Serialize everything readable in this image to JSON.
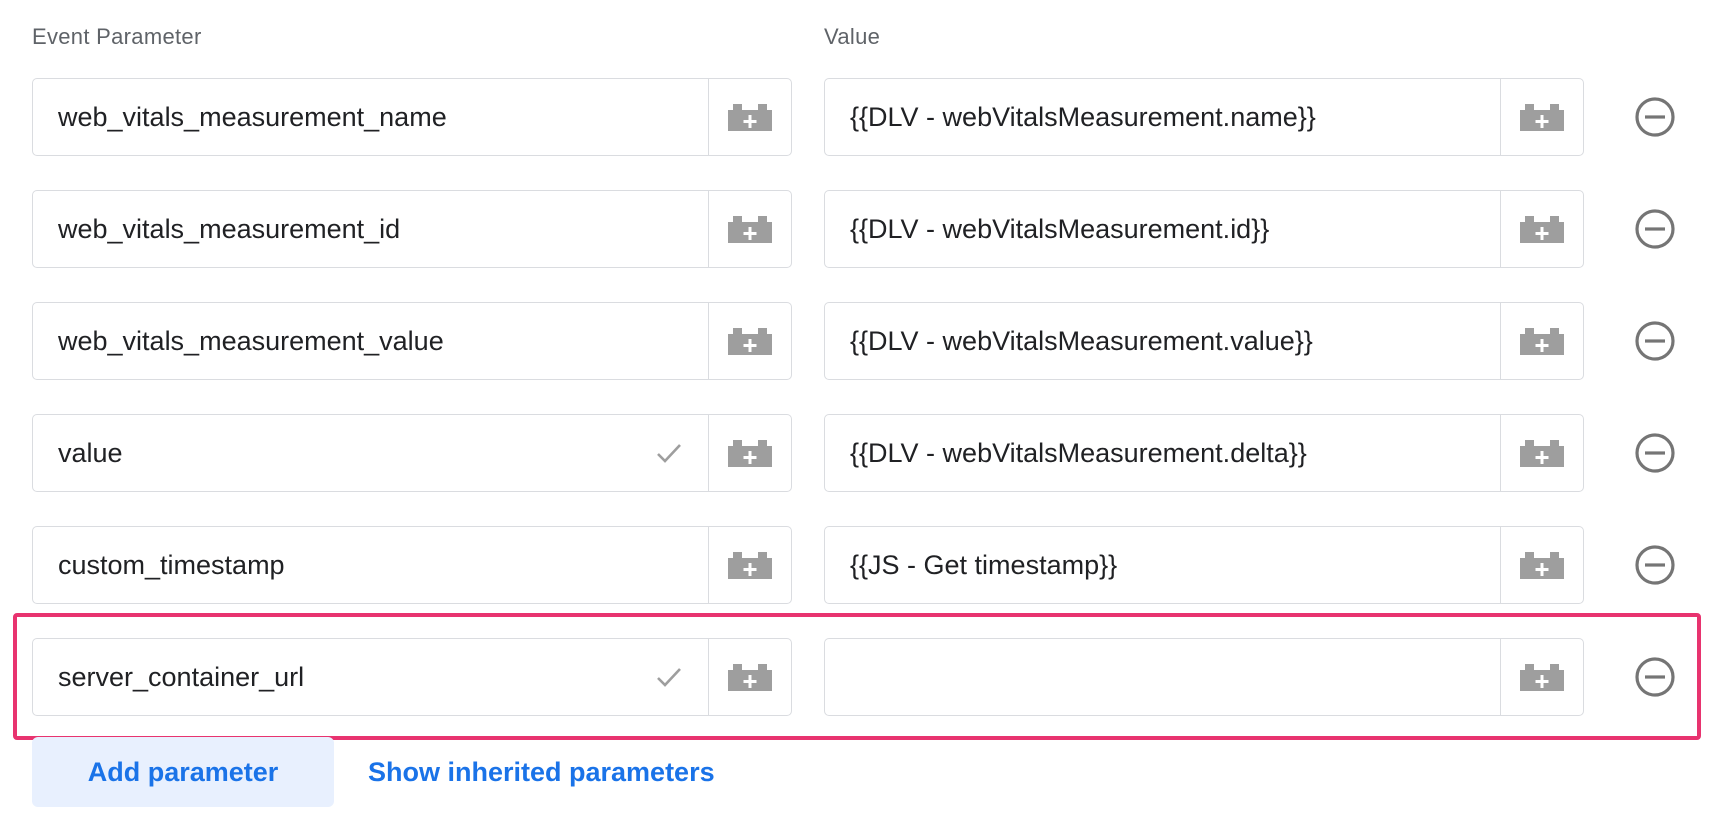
{
  "headers": {
    "param": "Event Parameter",
    "value": "Value"
  },
  "rows": [
    {
      "param": "web_vitals_measurement_name",
      "value": "{{DLV - webVitalsMeasurement.name}}",
      "param_validated": false
    },
    {
      "param": "web_vitals_measurement_id",
      "value": "{{DLV - webVitalsMeasurement.id}}",
      "param_validated": false
    },
    {
      "param": "web_vitals_measurement_value",
      "value": "{{DLV - webVitalsMeasurement.value}}",
      "param_validated": false
    },
    {
      "param": "value",
      "value": "{{DLV - webVitalsMeasurement.delta}}",
      "param_validated": true
    },
    {
      "param": "custom_timestamp",
      "value": "{{JS - Get timestamp}}",
      "param_validated": false
    },
    {
      "param": "server_container_url",
      "value": "",
      "param_validated": true,
      "highlighted": true
    }
  ],
  "buttons": {
    "add": "Add parameter",
    "inherited": "Show inherited parameters"
  },
  "icons": {
    "picker": "variable-picker-icon",
    "remove": "remove-circle-icon",
    "check": "checkmark-icon"
  },
  "colors": {
    "accent": "#1a73e8",
    "highlight": "#e8336f",
    "icon_gray": "#9e9e9e",
    "border": "#dadce0"
  }
}
